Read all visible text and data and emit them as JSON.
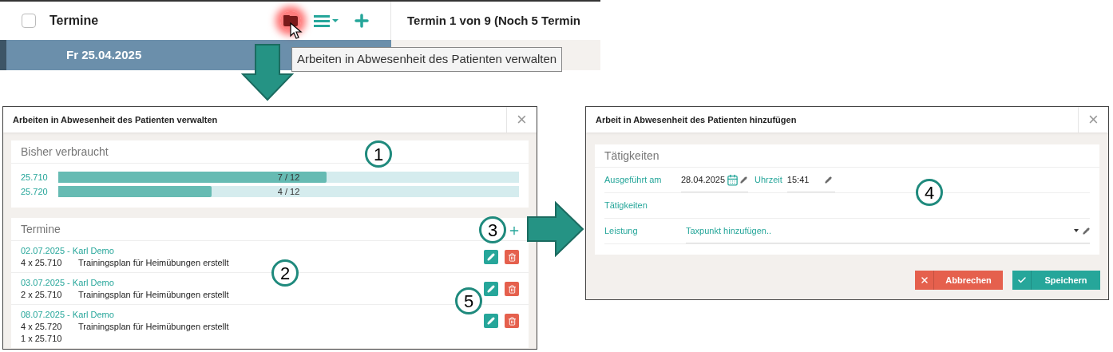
{
  "top_bar": {
    "checkbox": {
      "checked": false
    },
    "title": "Termine",
    "right_title": "Termin 1 von 9 (Noch 5 Termin",
    "selected_row": {
      "label": "Fr 25.04.2025",
      "selected": true
    },
    "tooltip": "Arbeiten in Abwesenheit des Patienten verwalten"
  },
  "manage_dialog": {
    "title": "Arbeiten in Abwesenheit des Patienten verwalten",
    "close": "×",
    "usage": {
      "title": "Bisher verbraucht",
      "bars": [
        {
          "code": "25.710",
          "reading": "7 / 12",
          "level": 0.583
        },
        {
          "code": "25.720",
          "reading": "4 / 12",
          "level": 0.333
        }
      ]
    },
    "appointments": {
      "title": "Termine",
      "items": [
        {
          "header": "02.07.2025 - Karl Demo",
          "lines": [
            {
              "quantity": "4 x 25.710",
              "description": "Trainingsplan für Heimübungen erstellt"
            }
          ]
        },
        {
          "header": "03.07.2025 - Karl Demo",
          "lines": [
            {
              "quantity": "2 x 25.710",
              "description": "Trainingsplan für Heimübungen erstellt"
            }
          ]
        },
        {
          "header": "08.07.2025 - Karl Demo",
          "lines": [
            {
              "quantity": "4 x 25.720",
              "description": "Trainingsplan für Heimübungen erstellt"
            },
            {
              "quantity": "1 x 25.710"
            }
          ]
        }
      ]
    }
  },
  "add_dialog": {
    "title": "Arbeit in Abwesenheit des Patienten hinzufügen",
    "close": "×",
    "section_title": "Tätigkeiten",
    "date_label": "Ausgeführt am",
    "date": "28.04.2025",
    "time_label": "Uhrzeit",
    "time": "15:41",
    "activities_label": "Tätigkeiten",
    "service_label": "Leistung",
    "service_placeholder": "Taxpunkt hinzufügen..",
    "buttons": [
      {
        "kind": "cancel",
        "label": "Abbrechen"
      },
      {
        "kind": "save",
        "label": "Speichern"
      }
    ]
  },
  "callouts": [
    "1",
    "2",
    "3",
    "4",
    "5"
  ]
}
